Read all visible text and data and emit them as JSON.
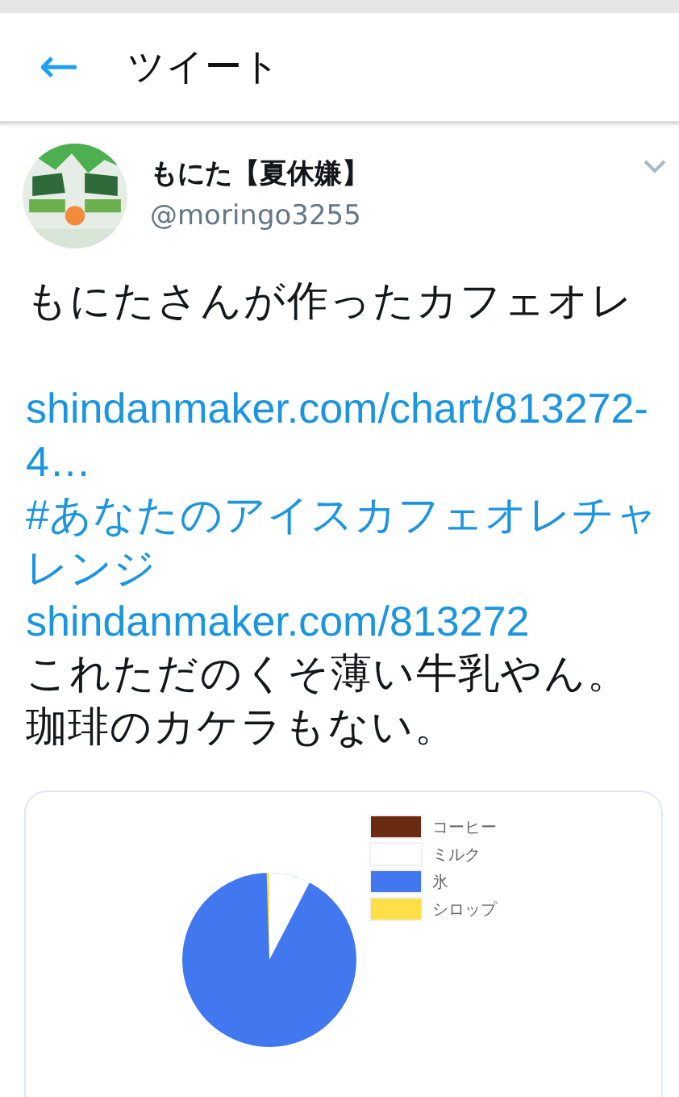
{
  "header": {
    "back": "←",
    "title": "ツイート"
  },
  "author": {
    "name": "もにた【夏休嫌】",
    "handle": "@moringo3255"
  },
  "body": [
    {
      "kind": "text",
      "text": "もにたさんが作ったカフェオレ"
    },
    {
      "kind": "gap"
    },
    {
      "kind": "link",
      "text": "shindanmaker.com/chart/813272-4…"
    },
    {
      "kind": "link",
      "text": "#あなたのアイスカフェオレチャレンジ"
    },
    {
      "kind": "link",
      "text": "shindanmaker.com/813272"
    },
    {
      "kind": "text",
      "text": "これただのくそ薄い牛乳やん。珈琲のカケラもない。"
    }
  ],
  "card": {
    "legend": [
      {
        "label": "コーヒー",
        "color": "#6b2a12"
      },
      {
        "label": "ミルク",
        "color": "#ffffff"
      },
      {
        "label": "氷",
        "color": "#4178f0"
      },
      {
        "label": "シロップ",
        "color": "#fde047"
      }
    ]
  }
}
